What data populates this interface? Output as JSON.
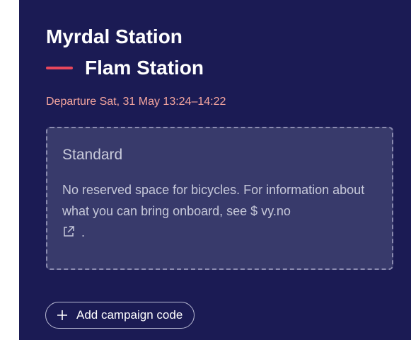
{
  "trip": {
    "from": "Myrdal Station",
    "to": "Flam Station",
    "departure": "Departure Sat, 31 May 13:24–14:22"
  },
  "ticket_info": {
    "title": "Standard",
    "text": "No reserved space for bicycles. For information about what you can bring onboard, see $ vy.no",
    "suffix": "."
  },
  "campaign": {
    "button_label": "Add campaign code"
  },
  "icons": {
    "route_dash": "route-line-icon",
    "external_link": "external-link-icon",
    "plus": "plus-icon"
  },
  "colors": {
    "panel_bg": "#1b1b54",
    "accent_red": "#e8475c",
    "departure_text": "#f4a59e",
    "info_box_bg": "#383a6b"
  }
}
